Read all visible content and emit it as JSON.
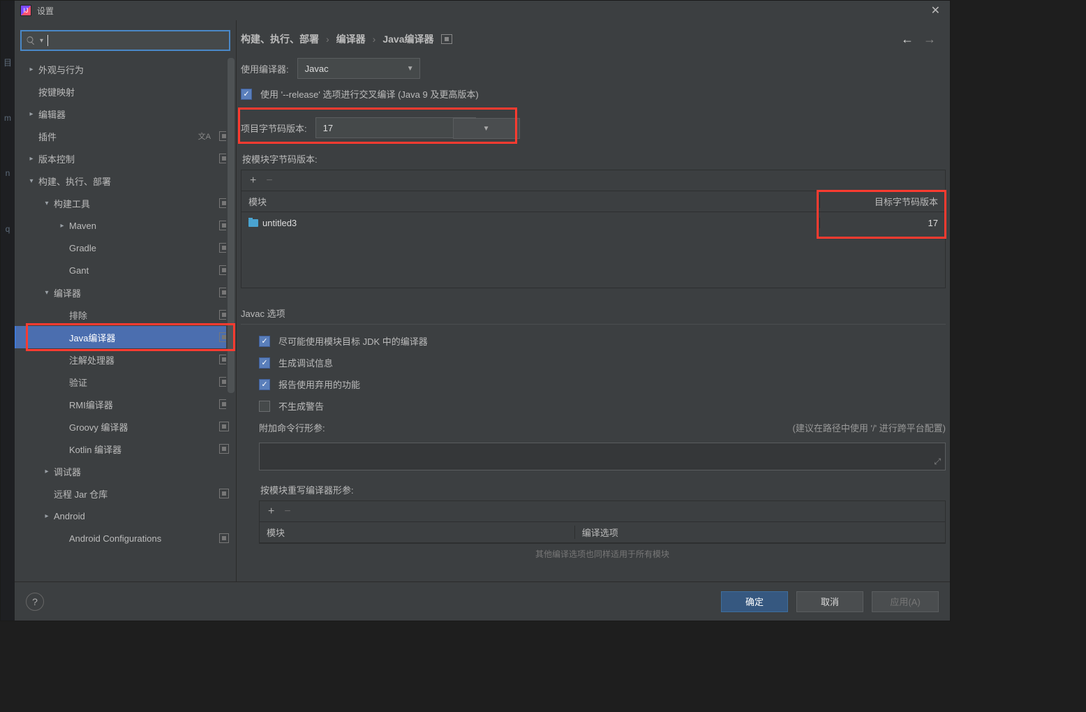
{
  "leftGutter": [
    "目",
    "m",
    "n",
    "q"
  ],
  "title": "设置",
  "search": {
    "placeholder": ""
  },
  "sidebar": [
    {
      "depth": 0,
      "arrow": ">",
      "label": "外观与行为",
      "badge": false
    },
    {
      "depth": 0,
      "arrow": "",
      "label": "按键映射",
      "badge": false
    },
    {
      "depth": 0,
      "arrow": ">",
      "label": "编辑器",
      "badge": false
    },
    {
      "depth": 0,
      "arrow": "",
      "label": "插件",
      "badge": true,
      "extraIcon": true
    },
    {
      "depth": 0,
      "arrow": ">",
      "label": "版本控制",
      "badge": true
    },
    {
      "depth": 0,
      "arrow": "v",
      "label": "构建、执行、部署",
      "badge": false
    },
    {
      "depth": 1,
      "arrow": "v",
      "label": "构建工具",
      "badge": true
    },
    {
      "depth": 2,
      "arrow": ">",
      "label": "Maven",
      "badge": true
    },
    {
      "depth": 2,
      "arrow": "",
      "label": "Gradle",
      "badge": true
    },
    {
      "depth": 2,
      "arrow": "",
      "label": "Gant",
      "badge": true
    },
    {
      "depth": 1,
      "arrow": "v",
      "label": "编译器",
      "badge": true
    },
    {
      "depth": 2,
      "arrow": "",
      "label": "排除",
      "badge": true
    },
    {
      "depth": 2,
      "arrow": "",
      "label": "Java编译器",
      "badge": true,
      "selected": true
    },
    {
      "depth": 2,
      "arrow": "",
      "label": "注解处理器",
      "badge": true
    },
    {
      "depth": 2,
      "arrow": "",
      "label": "验证",
      "badge": true
    },
    {
      "depth": 2,
      "arrow": "",
      "label": "RMI编译器",
      "badge": true
    },
    {
      "depth": 2,
      "arrow": "",
      "label": "Groovy 编译器",
      "badge": true
    },
    {
      "depth": 2,
      "arrow": "",
      "label": "Kotlin 编译器",
      "badge": true
    },
    {
      "depth": 1,
      "arrow": ">",
      "label": "调试器",
      "badge": false
    },
    {
      "depth": 1,
      "arrow": "",
      "label": "远程 Jar 仓库",
      "badge": true
    },
    {
      "depth": 1,
      "arrow": ">",
      "label": "Android",
      "badge": false
    },
    {
      "depth": 2,
      "arrow": "",
      "label": "Android Configurations",
      "badge": true
    }
  ],
  "breadcrumbs": [
    "构建、执行、部署",
    "编译器",
    "Java编译器"
  ],
  "fields": {
    "useCompilerLabel": "使用编译器:",
    "useCompilerValue": "Javac",
    "releaseCheckbox": "使用 '--release' 选项进行交叉编译 (Java 9 及更高版本)",
    "projectBytecodeLabel": "项目字节码版本:",
    "projectBytecodeValue": "17",
    "perModuleBytecodeLabel": "按模块字节码版本:",
    "table1": {
      "headers": [
        "模块",
        "目标字节码版本"
      ],
      "rows": [
        {
          "module": "untitled3",
          "version": "17"
        }
      ]
    },
    "javacSection": "Javac 选项",
    "cb1": "尽可能使用模块目标 JDK 中的编译器",
    "cb2": "生成调试信息",
    "cb3": "报告使用弃用的功能",
    "cb4": "不生成警告",
    "additionalParamsLabel": "附加命令行形参:",
    "additionalParamsHint": "(建议在路径中使用 '/' 进行跨平台配置)",
    "overrideSection": "按模块重写编译器形参:",
    "table2": {
      "headers": [
        "模块",
        "编译选项"
      ]
    },
    "bottomHint": "其他编译选项也同样适用于所有模块"
  },
  "footer": {
    "ok": "确定",
    "cancel": "取消",
    "apply": "应用(A)"
  }
}
